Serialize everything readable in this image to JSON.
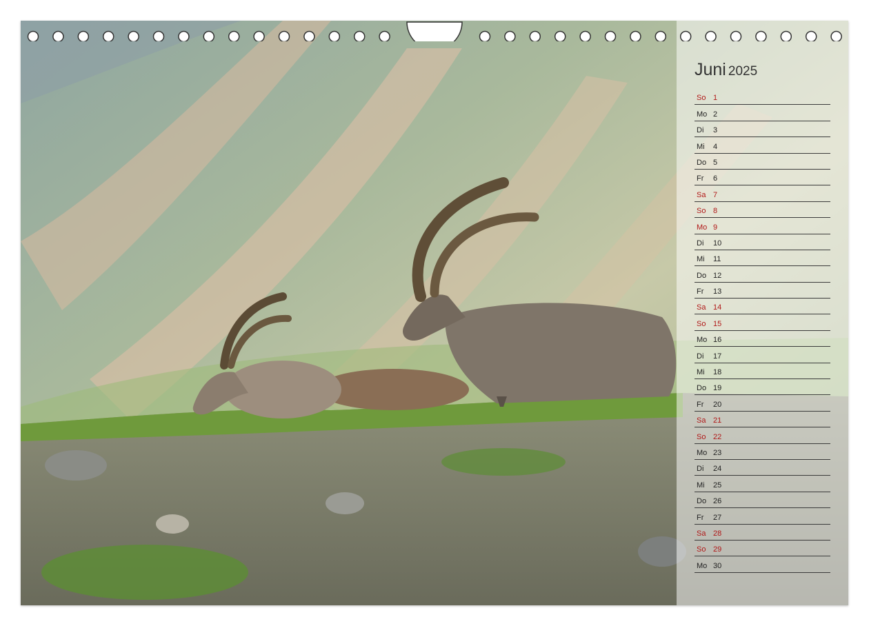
{
  "calendar": {
    "month": "Juni",
    "year": "2025",
    "days": [
      {
        "wd": "So",
        "d": "1",
        "holiday": true
      },
      {
        "wd": "Mo",
        "d": "2",
        "holiday": false
      },
      {
        "wd": "Di",
        "d": "3",
        "holiday": false
      },
      {
        "wd": "Mi",
        "d": "4",
        "holiday": false
      },
      {
        "wd": "Do",
        "d": "5",
        "holiday": false
      },
      {
        "wd": "Fr",
        "d": "6",
        "holiday": false
      },
      {
        "wd": "Sa",
        "d": "7",
        "holiday": true
      },
      {
        "wd": "So",
        "d": "8",
        "holiday": true
      },
      {
        "wd": "Mo",
        "d": "9",
        "holiday": true
      },
      {
        "wd": "Di",
        "d": "10",
        "holiday": false
      },
      {
        "wd": "Mi",
        "d": "11",
        "holiday": false
      },
      {
        "wd": "Do",
        "d": "12",
        "holiday": false
      },
      {
        "wd": "Fr",
        "d": "13",
        "holiday": false
      },
      {
        "wd": "Sa",
        "d": "14",
        "holiday": true
      },
      {
        "wd": "So",
        "d": "15",
        "holiday": true
      },
      {
        "wd": "Mo",
        "d": "16",
        "holiday": false
      },
      {
        "wd": "Di",
        "d": "17",
        "holiday": false
      },
      {
        "wd": "Mi",
        "d": "18",
        "holiday": false
      },
      {
        "wd": "Do",
        "d": "19",
        "holiday": false
      },
      {
        "wd": "Fr",
        "d": "20",
        "holiday": false
      },
      {
        "wd": "Sa",
        "d": "21",
        "holiday": true
      },
      {
        "wd": "So",
        "d": "22",
        "holiday": true
      },
      {
        "wd": "Mo",
        "d": "23",
        "holiday": false
      },
      {
        "wd": "Di",
        "d": "24",
        "holiday": false
      },
      {
        "wd": "Mi",
        "d": "25",
        "holiday": false
      },
      {
        "wd": "Do",
        "d": "26",
        "holiday": false
      },
      {
        "wd": "Fr",
        "d": "27",
        "holiday": false
      },
      {
        "wd": "Sa",
        "d": "28",
        "holiday": true
      },
      {
        "wd": "So",
        "d": "29",
        "holiday": true
      },
      {
        "wd": "Mo",
        "d": "30",
        "holiday": false
      }
    ]
  },
  "colors": {
    "holiday_text": "#b01818",
    "regular_text": "#222222",
    "rule_line": "#3a3a3a"
  },
  "photo": {
    "subject": "two alpine ibex resting on a grassy mountain ridge",
    "icon": "ibex-photo"
  }
}
